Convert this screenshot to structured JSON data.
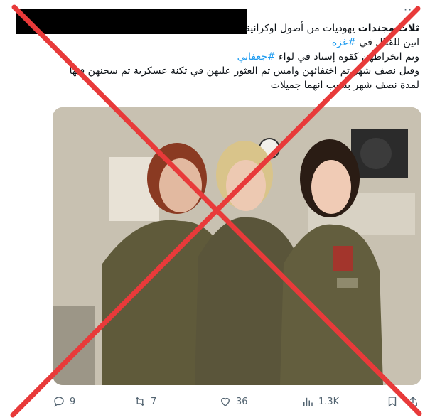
{
  "tweet": {
    "lines": [
      {
        "bold": "ثلاث مجندات",
        "text": " يهوديات من أصول اوكرانية"
      },
      {
        "text": "اتين للقتال في ",
        "hashtag": "#غزة"
      },
      {
        "text": "وتم انخراطهن كقوة إسناد في لواء ",
        "hashtag": "#جعفاتي"
      },
      {
        "text": "وقبل نصف شهر تم اختفائهن وامس تم العثور عليهن في ثكنة عسكرية تم سجنهن فيها"
      },
      {
        "text": "لمدة نصف شهر بسبب انهما جميلات"
      }
    ]
  },
  "photo": {
    "alt": "",
    "colors": {
      "uniform": "#5f5a3a",
      "wall": "#c9c2b3",
      "hair_red": "#8a3a22",
      "hair_blond": "#d9c48a",
      "hair_dark": "#2a1c14"
    }
  },
  "actions": {
    "replies": "9",
    "reposts": "7",
    "likes": "36",
    "views": "1.3K"
  },
  "overlay": {
    "cross_color": "#e83a3a"
  }
}
